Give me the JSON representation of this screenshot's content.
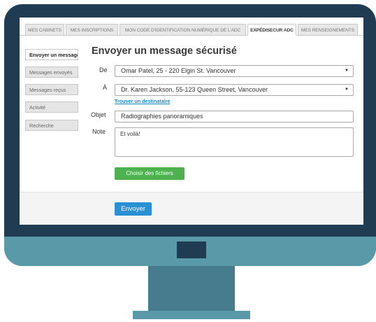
{
  "tabs": [
    {
      "label": "MES CABINETS"
    },
    {
      "label": "MES INSCRIPTIONS"
    },
    {
      "label": "MON CODE D'IDENTIFICATION NUMÉRIQUE DE L'ADC"
    },
    {
      "label": "EXPÉDISECUR ADC"
    },
    {
      "label": "MES RENSEIGNEMENTS"
    }
  ],
  "sidebar": {
    "items": [
      {
        "label": "Envoyer un message"
      },
      {
        "label": "Messages envoyés"
      },
      {
        "label": "Messages reçus"
      },
      {
        "label": "Activité"
      },
      {
        "label": "Recherche"
      }
    ]
  },
  "form": {
    "title": "Envoyer un message sécurisé",
    "from_label": "De",
    "from_value": "Omar Patel, 25 - 220 Elgin St. Vancouver",
    "to_label": "À",
    "to_value": "Dr. Karen Jackson, 55-123 Queen Street, Vancouver",
    "find_recipient": "Trouver un destinataire",
    "subject_label": "Objet",
    "subject_value": "Radiographies panoramiques",
    "note_label": "Note",
    "note_value": "Et voilà!",
    "choose_files": "Choisir des fichiers",
    "send": "Envoyer"
  },
  "colors": {
    "bezel": "#1f3c53",
    "stand": "#5a9aa8",
    "send_button": "#2a90d4",
    "files_button": "#4db14f"
  }
}
